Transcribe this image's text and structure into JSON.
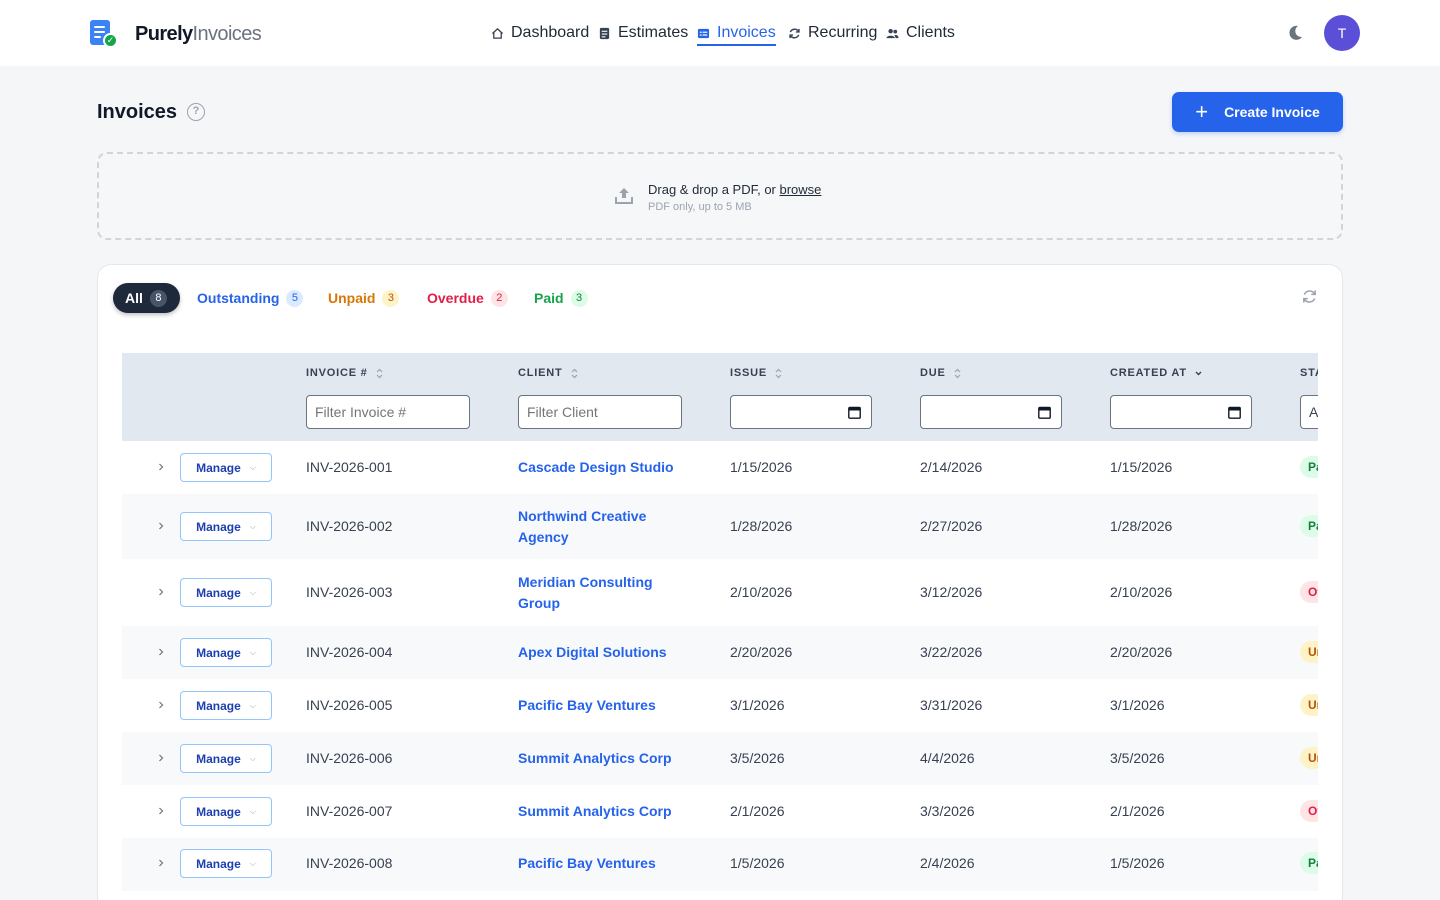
{
  "brand": {
    "name_bold": "Purely",
    "name_light": "Invoices"
  },
  "nav": [
    {
      "label": "Dashboard",
      "icon": "home-icon"
    },
    {
      "label": "Estimates",
      "icon": "document-icon"
    },
    {
      "label": "Invoices",
      "icon": "invoice-icon",
      "active": true
    },
    {
      "label": "Recurring",
      "icon": "recurring-icon"
    },
    {
      "label": "Clients",
      "icon": "users-icon"
    }
  ],
  "user": {
    "initial": "T"
  },
  "page": {
    "title": "Invoices",
    "help": "?",
    "create_label": "Create Invoice",
    "create_plus": "+"
  },
  "dropzone": {
    "title_prefix": "Drag & drop a PDF, or ",
    "browse": "browse",
    "subtitle": "PDF only, up to 5 MB"
  },
  "tabs": [
    {
      "label": "All",
      "count": "8"
    },
    {
      "label": "Outstanding",
      "count": "5"
    },
    {
      "label": "Unpaid",
      "count": "3"
    },
    {
      "label": "Overdue",
      "count": "2"
    },
    {
      "label": "Paid",
      "count": "3"
    }
  ],
  "table": {
    "headers": {
      "invoice": "INVOICE #",
      "client": "CLIENT",
      "issue": "ISSUE",
      "due": "DUE",
      "created": "CREATED AT",
      "status": "STATUS"
    },
    "filters": {
      "invoice_placeholder": "Filter Invoice #",
      "client_placeholder": "Filter Client",
      "status_value": "All"
    },
    "manage_label": "Manage",
    "rows": [
      {
        "invoice": "INV-2026-001",
        "client": "Cascade Design Studio",
        "issue": "1/15/2026",
        "due": "2/14/2026",
        "created": "1/15/2026",
        "status": "Paid"
      },
      {
        "invoice": "INV-2026-002",
        "client": "Northwind Creative Agency",
        "issue": "1/28/2026",
        "due": "2/27/2026",
        "created": "1/28/2026",
        "status": "Paid"
      },
      {
        "invoice": "INV-2026-003",
        "client": "Meridian Consulting Group",
        "issue": "2/10/2026",
        "due": "3/12/2026",
        "created": "2/10/2026",
        "status": "Overdue"
      },
      {
        "invoice": "INV-2026-004",
        "client": "Apex Digital Solutions",
        "issue": "2/20/2026",
        "due": "3/22/2026",
        "created": "2/20/2026",
        "status": "Unpaid"
      },
      {
        "invoice": "INV-2026-005",
        "client": "Pacific Bay Ventures",
        "issue": "3/1/2026",
        "due": "3/31/2026",
        "created": "3/1/2026",
        "status": "Unpaid"
      },
      {
        "invoice": "INV-2026-006",
        "client": "Summit Analytics Corp",
        "issue": "3/5/2026",
        "due": "4/4/2026",
        "created": "3/5/2026",
        "status": "Unpaid"
      },
      {
        "invoice": "INV-2026-007",
        "client": "Summit Analytics Corp",
        "issue": "2/1/2026",
        "due": "3/3/2026",
        "created": "2/1/2026",
        "status": "Overdue"
      },
      {
        "invoice": "INV-2026-008",
        "client": "Pacific Bay Ventures",
        "issue": "1/5/2026",
        "due": "2/4/2026",
        "created": "1/5/2026",
        "status": "Paid"
      }
    ]
  },
  "colors": {
    "primary": "#2563eb",
    "dark": "#1e293b",
    "paid": "#16a34a",
    "unpaid": "#d97706",
    "overdue": "#e11d48"
  }
}
